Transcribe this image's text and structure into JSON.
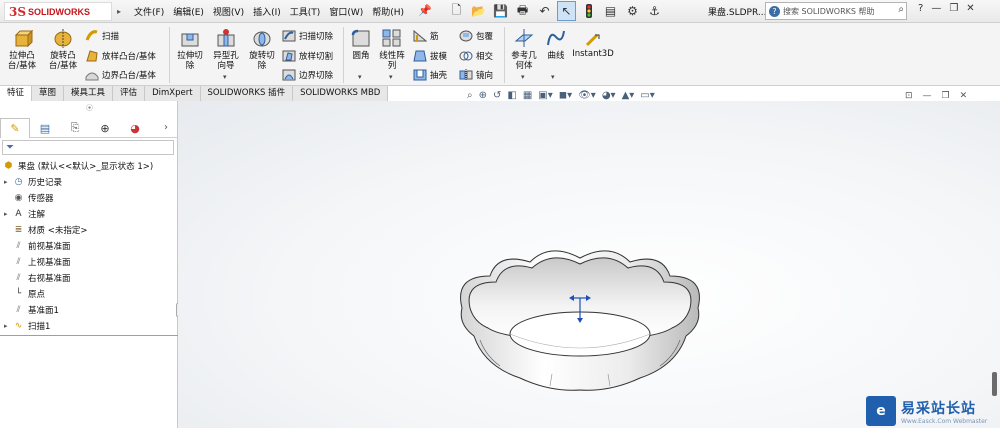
{
  "app": {
    "logo_mark": "3S",
    "logo_text": "SOLIDWORKS",
    "document_title": "果盘.SLDPR..."
  },
  "menu": [
    "文件(F)",
    "编辑(E)",
    "视图(V)",
    "插入(I)",
    "工具(T)",
    "窗口(W)",
    "帮助(H)"
  ],
  "quick_access": [
    "new-icon",
    "open-icon",
    "save-icon",
    "print-icon",
    "undo-icon",
    "select-arrow-icon",
    "traffic-light-icon",
    "options-icon",
    "gear-icon",
    "anchor-icon"
  ],
  "help_search": {
    "placeholder": "搜索 SOLIDWORKS 帮助"
  },
  "ribbon": {
    "extrude_boss": "拉伸凸\n台/基体",
    "revolve_boss": "旋转凸\n台/基体",
    "sweep": "扫描",
    "loft_boss": "放样凸台/基体",
    "boundary_boss": "边界凸台/基体",
    "extrude_cut": "拉伸切\n除",
    "hole_wizard": "异型孔\n向导",
    "revolve_cut": "旋转切\n除",
    "swept_cut": "扫描切除",
    "lofted_cut": "放样切割",
    "boundary_cut": "边界切除",
    "fillet": "圆角",
    "linear_pattern": "线性阵\n列",
    "rib": "筋",
    "draft": "拔模",
    "shell": "抽壳",
    "wrap": "包覆",
    "intersect": "相交",
    "mirror": "镜向",
    "reference_geometry": "参考几\n何体",
    "curves": "曲线",
    "instant3d": "Instant3D"
  },
  "command_tabs": [
    "特征",
    "草图",
    "模具工具",
    "评估",
    "DimXpert",
    "SOLIDWORKS 插件",
    "SOLIDWORKS MBD"
  ],
  "feature_tree": {
    "root": "果盘  (默认<<默认>_显示状态 1>)",
    "items": [
      "历史记录",
      "传感器",
      "注解",
      "材质 <未指定>",
      "前视基准面",
      "上视基准面",
      "右视基准面",
      "原点",
      "基准面1",
      "扫描1"
    ]
  },
  "watermark": {
    "mark": "e",
    "title": "易采站长站",
    "subtitle": "Www.Easck.Com Webmaster"
  },
  "colors": {
    "accent": "#3a6ea5",
    "brand_red": "#c4161c",
    "watermark_blue": "#1f5fae"
  }
}
